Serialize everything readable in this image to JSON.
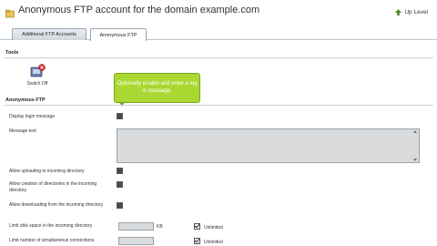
{
  "header": {
    "title": "Anonymous FTP account for the domain example.com",
    "up_level": "Up Level",
    "title_icon": "folder-icon",
    "up_level_icon": "up-arrow-icon"
  },
  "tabs": [
    {
      "label": "Additional FTP Accounts",
      "active": false
    },
    {
      "label": "Anonymous FTP",
      "active": true
    }
  ],
  "tools": {
    "section_title": "Tools",
    "items": [
      {
        "label": "Switch Off",
        "icon": "switch-off-icon"
      }
    ]
  },
  "tooltip": {
    "text": "Optionally enable and enter a log in message."
  },
  "anon_ftp": {
    "section_title": "Anonymous FTP",
    "display_login_message": {
      "label": "Display login message",
      "checked": true
    },
    "message_text": {
      "label": "Message text",
      "value": ""
    },
    "allow_uploading": {
      "label": "Allow uploading to incoming directory",
      "checked": true
    },
    "allow_creation": {
      "label": "Allow creation of directories in the incoming directory",
      "checked": true
    },
    "allow_downloading": {
      "label": "Allow downloading from the incoming directory",
      "checked": true
    },
    "limit_disk_space": {
      "label": "Limit disk space in the incoming directory",
      "unit": "KB",
      "unlimited_label": "Unlimited",
      "unlimited_checked": true
    },
    "limit_connections": {
      "label": "Limit number of simultaneous connections",
      "unlimited_label": "Unlimited",
      "unlimited_checked": true
    }
  },
  "colors": {
    "tooltip_bg": "#a9d832",
    "accent_border": "#b8c4cf"
  }
}
